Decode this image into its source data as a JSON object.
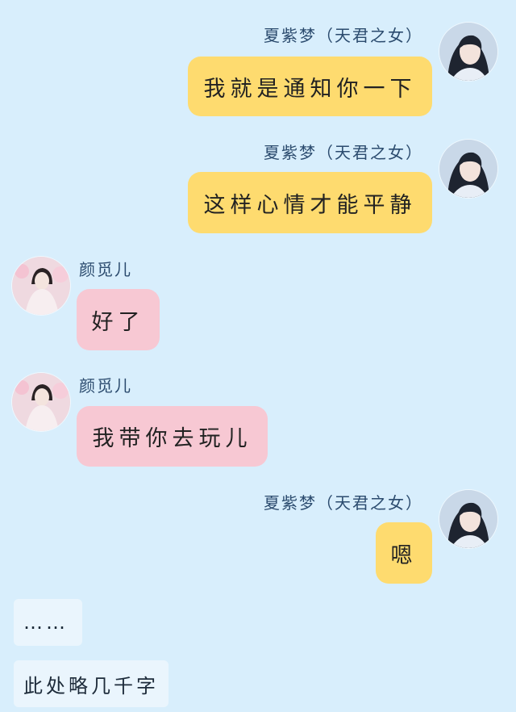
{
  "colors": {
    "background": "#d8eefc",
    "my_bubble": "#fedb6f",
    "other_bubble": "#f7c8d3",
    "note_bubble": "#eaf5fd",
    "name_text": "#2b4b6e"
  },
  "messages": [
    {
      "sender": "夏紫梦（天君之女）",
      "text": "我就是通知你一下",
      "side": "right"
    },
    {
      "sender": "夏紫梦（天君之女）",
      "text": "这样心情才能平静",
      "side": "right"
    },
    {
      "sender": "颜觅儿",
      "text": "好了",
      "side": "left"
    },
    {
      "sender": "颜觅儿",
      "text": "我带你去玩儿",
      "side": "left"
    },
    {
      "sender": "夏紫梦（天君之女）",
      "text": "嗯",
      "side": "right"
    }
  ],
  "notes": [
    "……",
    "此处略几千字"
  ]
}
